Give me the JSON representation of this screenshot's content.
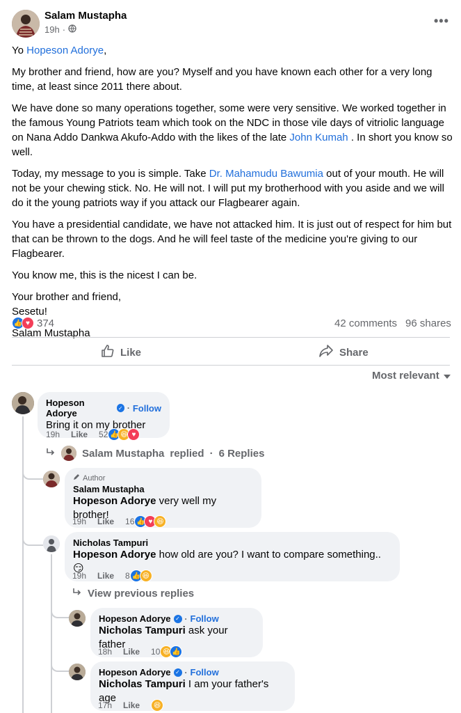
{
  "post": {
    "author": "Salam Mustapha",
    "time": "19h",
    "text_greeting_prefix": "Yo ",
    "mention_1": "Hopeson Adorye",
    "text_greeting_suffix": ",",
    "para_1": "My brother and friend, how are you? Myself and you have known each other for a very long time, at least since 2011 there about.",
    "para_2a": "We have done so many operations together,  some were very sensitive. We worked together in the famous Young Patriots team which took on the NDC in those vile days of vitriolic language on Nana Addo Dankwa Akufo-Addo with the likes of the late ",
    "mention_2": "John Kumah",
    "para_2b": " . In short you know so well.",
    "para_3a": "Today, my message to you is simple. Take  ",
    "mention_3": "Dr. Mahamudu Bawumia",
    "para_3b": " out of your mouth. He will not be your chewing stick. No. He will not. I will put my brotherhood with you aside and we will do it the young patriots way if you attack our Flagbearer again.",
    "para_4": "You have a presidential candidate, we have not attacked him. It is just out of respect for him but that can be thrown to the dogs. And he will feel taste of the medicine you're giving to our Flagbearer.",
    "para_5": "You know me, this is the nicest I can be.",
    "para_6a": "Your brother and friend,",
    "para_6b": "Sesetu!",
    "para_7": "Salam Mustapha",
    "reaction_count": "374",
    "comments_count": "42 comments",
    "shares_count": "96 shares"
  },
  "actions": {
    "like": "Like",
    "share": "Share"
  },
  "sort_label": "Most relevant",
  "comments": [
    {
      "name": "Hopeson Adorye",
      "follow": "Follow",
      "text": "Bring it on my brother",
      "time": "19h",
      "like": "Like",
      "count": "52"
    }
  ],
  "reply_summary": {
    "name": "Salam Mustapha",
    "label": "replied",
    "replies": "6 Replies"
  },
  "replies": [
    {
      "author_tag": "Author",
      "name": "Salam Mustapha",
      "mention": "Hopeson Adorye",
      "text": " very well my brother!",
      "time": "19h",
      "like": "Like",
      "count": "16"
    },
    {
      "name": "Nicholas Tampuri",
      "mention": "Hopeson Adorye",
      "text": " how old are you? I want to compare something..😏",
      "time": "19h",
      "like": "Like",
      "count": "8"
    }
  ],
  "view_previous": "View previous replies",
  "nested": [
    {
      "name": "Hopeson Adorye",
      "follow": "Follow",
      "mention": "Nicholas Tampuri",
      "text": " ask your father",
      "time": "18h",
      "like": "Like",
      "count": "10"
    },
    {
      "name": "Hopeson Adorye",
      "follow": "Follow",
      "mention": "Nicholas Tampuri",
      "text": " I am your father's age",
      "time": "17h",
      "like": "Like"
    }
  ]
}
